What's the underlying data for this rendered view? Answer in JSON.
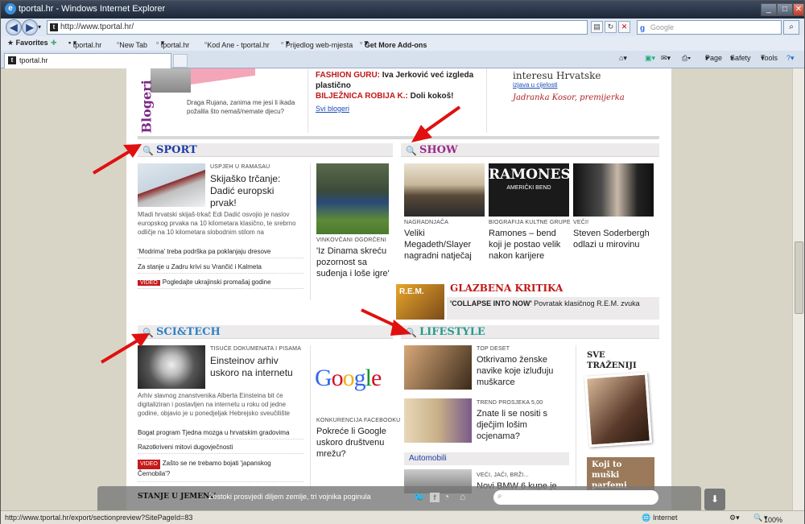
{
  "window": {
    "title": "tportal.hr - Windows Internet Explorer"
  },
  "address": {
    "url": "http://www.tportal.hr/",
    "search_placeholder": "Google"
  },
  "favorites": {
    "label": "Favorites",
    "items": [
      "tportal.hr",
      "New Tab",
      "tportal.hr",
      "Kod Ane - tportal.hr",
      "Prijedlog web-mjesta",
      "Get More Add-ons"
    ]
  },
  "tab": {
    "label": "tportal.hr"
  },
  "commands": {
    "page": "Page",
    "safety": "Safety",
    "tools": "Tools"
  },
  "top": {
    "blogeri_label": "Blogeri",
    "blog_text": "Draga Rujana, zanima me jesi li ikada požalila što nemaš/nemate djecu?",
    "fashion_kicker": "FASHION GURU:",
    "fashion_text": " Iva Jerković već izgleda plastično",
    "biljeznica_kicker": "BILJEŽNICA ROBIJA K.:",
    "biljeznica_text": " Doli kokoš!",
    "svi_blogeri": "Svi blogeri",
    "quote_tail": "interesu Hrvatske",
    "quote_link": "izjava u cijelosti",
    "quote_author": "Jadranka Kosor, premijerka"
  },
  "sport": {
    "title": "SPORT",
    "main_kicker": "USPJEH U RAMASAU",
    "main_head": "Skijaško trčanje: Dadić europski prvak!",
    "main_body": "Mladi hrvatski skijaš-trkač Edi Dadić osvojio je naslov europskog prvaka na 10 kilometara klasično, te srebrno odličje na 10 kilometara slobodnim stilom na",
    "side_kicker": "VINKOVČANI OGORČENI",
    "side_head": "'Iz Dinama skreću pozornost sa suđenja i loše igre'",
    "links": [
      "'Modrima' treba podrška pa poklanjaju dresove",
      "Za stanje u Zadru krivi su Vrančić i Kalmeta"
    ],
    "video_label": "VIDEO",
    "video_link": "Pogledajte ukrajinski promašaj godine"
  },
  "show": {
    "title": "SHOW",
    "items": [
      {
        "kicker": "NAGRADNJAČA",
        "head": "Veliki Megadeth/Slayer nagradni natječaj"
      },
      {
        "kicker": "BIOGRAFIJA KULTNE GRUPE",
        "head": "Ramones – bend koji je postao velik nakon karijere"
      },
      {
        "kicker": "VEČI!",
        "head": "Steven Soderbergh odlazi u mirovinu"
      }
    ],
    "ramones_top": "RAMONES",
    "ramones_sub": "AMERIČKI BEND",
    "kritika_title": "GLAZBENA KRITIKA",
    "kritika_kicker": "'COLLAPSE INTO NOW'",
    "kritika_text": " Povratak klasičnog R.E.M. zvuka",
    "rem": "R.E.M."
  },
  "scitech": {
    "title": "SCI&TECH",
    "main_kicker": "TISUĆE DOKUMENATA I PISAMA",
    "main_head": "Einsteinov arhiv uskoro na internetu",
    "main_body": "Arhiv slavnog znanstvenika Alberta Einsteina bit će digitaliziran i postavljen na internetu u roku od jedne godine, objavio je u ponedjeljak Hebrejsko sveučilište",
    "side_kicker": "KONKURENCIJA FACEBOOKU",
    "side_head": "Pokreće li Google uskoro društvenu mrežu?",
    "google": "Google",
    "links": [
      "Bogat program Tjedna mozga u hrvatskim gradovima",
      "Razotkriveni mitovi dugovječnosti"
    ],
    "video_label": "VIDEO",
    "video_link": "Zašto se ne trebamo bojati 'japanskog Černobila'?"
  },
  "lifestyle": {
    "title": "LIFESTYLE",
    "items": [
      {
        "kicker": "TOP DESET",
        "head": "Otkrivamo ženske navike koje izluđuju muškarce"
      },
      {
        "kicker": "TREND PROSJEKA 5,00",
        "head": "Znate li se nositi s dječjim lošim ocjenama?"
      }
    ],
    "automobili": "Automobili",
    "auto_kicker": "VEĆI, JAČI, BRŽI...",
    "auto_head": "Novi BMW 6 kupe je",
    "sve_trazeniji": "SVE TRAŽENIJI",
    "koji_to": "Koji to muški parfemi vrijede"
  },
  "ticker": {
    "label": "STANJE U JEMENU",
    "text": "Žestoki prosvjedi diljem zemlje, tri vojnika poginula"
  },
  "status": {
    "url": "http://www.tportal.hr/export/sectionpreview?SitePageId=83",
    "zone": "Internet",
    "zoom": "100%"
  },
  "colors": {
    "sport": "#1d3ea8",
    "show": "#9b2a8a",
    "scitech": "#2f82c6",
    "lifestyle": "#2a9b8e",
    "kritika": "#c01818",
    "arrow": "#e01010"
  }
}
